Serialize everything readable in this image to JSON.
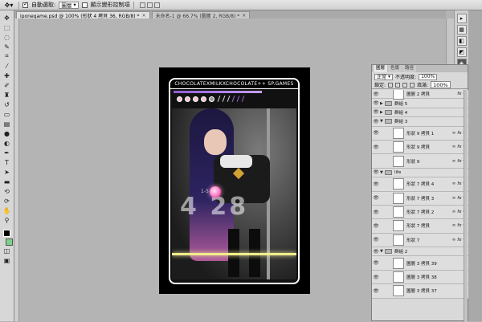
{
  "options_bar": {
    "auto_select_label": "自動選取:",
    "auto_select_value": "圖層",
    "show_transform_label": "顯示變形控制項"
  },
  "tabs": [
    {
      "label": "iponegame.psd @ 100% (形狀 4 拷貝 36, RGB/8) *",
      "active": true
    },
    {
      "label": "未命名-1 @ 66.7% (圖層 2, RGB/8) *",
      "active": false
    }
  ],
  "canvas": {
    "banner_text": "CHOCOLATEXMILKXCHOCOLATE++ SP.GAMES",
    "big_number": "4 28",
    "small_label": "1-5"
  },
  "layers_panel": {
    "tabs": [
      "圖層",
      "色版",
      "路徑"
    ],
    "blend_mode": "正常",
    "opacity_label": "不透明度:",
    "opacity_value": "100%",
    "lock_label": "鎖定:",
    "fill_label": "填滿:",
    "fill_value": "100%",
    "layers": [
      {
        "name": "圖層 2 拷貝",
        "type": "layer",
        "eye": true,
        "fx": true
      },
      {
        "name": "群組 5",
        "type": "group",
        "eye": true
      },
      {
        "name": "群組 4",
        "type": "group",
        "eye": true
      },
      {
        "name": "群組 3",
        "type": "group",
        "eye": true,
        "open": true
      },
      {
        "name": "形狀 9 拷貝 1",
        "type": "shape",
        "eye": true,
        "fx": true
      },
      {
        "name": "形狀 9 拷貝",
        "type": "shape",
        "eye": true,
        "fx": true
      },
      {
        "name": "形狀 9",
        "type": "shape",
        "eye": false,
        "fx": true
      },
      {
        "name": "life",
        "type": "group",
        "eye": true,
        "open": true
      },
      {
        "name": "形狀 7 拷貝 4",
        "type": "shape",
        "eye": true,
        "fx": true
      },
      {
        "name": "形狀 7 拷貝 3",
        "type": "shape",
        "eye": true,
        "fx": true
      },
      {
        "name": "形狀 7 拷貝 2",
        "type": "shape",
        "eye": true,
        "fx": true
      },
      {
        "name": "形狀 7 拷貝",
        "type": "shape",
        "eye": true,
        "fx": true
      },
      {
        "name": "形狀 7",
        "type": "shape",
        "eye": true,
        "fx": true
      },
      {
        "name": "群組 2",
        "type": "group",
        "eye": true,
        "open": true
      },
      {
        "name": "圖層 3 拷貝 39",
        "type": "shape",
        "eye": true,
        "fx": false
      },
      {
        "name": "圖層 3 拷貝 38",
        "type": "shape",
        "eye": true,
        "fx": false
      },
      {
        "name": "圖層 3 拷貝 37",
        "type": "shape",
        "eye": true,
        "fx": false
      }
    ]
  }
}
